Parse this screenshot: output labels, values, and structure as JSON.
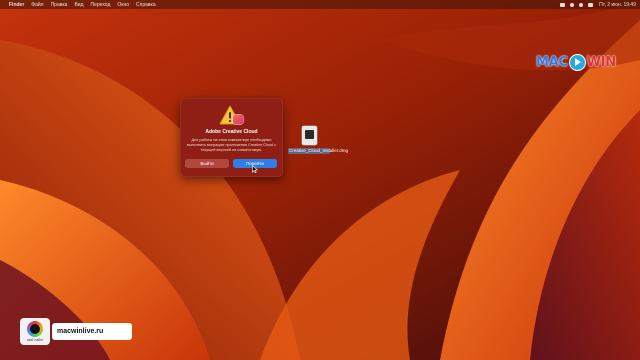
{
  "menubar": {
    "apple_glyph": "",
    "items": [
      "Finder",
      "Файл",
      "Правка",
      "Вид",
      "Переход",
      "Окно",
      "Справка"
    ],
    "clock": "Пт, 2 июн. 19:49"
  },
  "watermark": {
    "left": "MAC",
    "right": "WIN"
  },
  "dialog": {
    "title": "Adobe Creative Cloud",
    "message": "Для работы на этом компьютере необходимо выполнить миграцию приложения Creative Cloud с текущей версией на совместимую.",
    "exit_button": "Выйти",
    "go_button": "Перейти"
  },
  "desktop": {
    "file_name": "Creative_Cloud_Installer.dmg"
  },
  "site_badge": {
    "logo_caption": "мой сайт",
    "url": "macwinlive.ru"
  },
  "colors": {
    "dialog_bg": "#8f1e14",
    "primary_button": "#2f7ee8",
    "secondary_button": "#b2473e"
  }
}
